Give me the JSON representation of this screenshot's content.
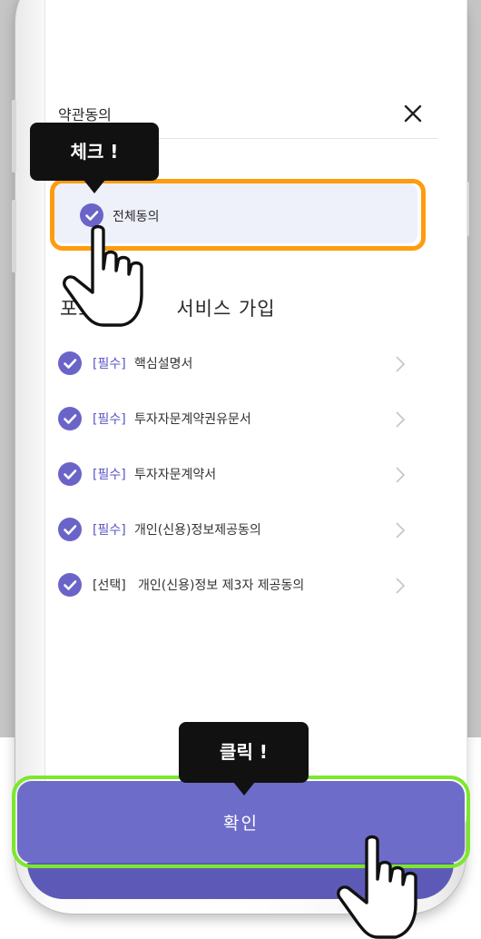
{
  "header": {
    "title": "약관동의",
    "close_icon": "close-icon"
  },
  "tooltips": {
    "check": "체크 !",
    "click": "클릭 !"
  },
  "all_agree": {
    "label": "전체동의",
    "checked": true
  },
  "section": {
    "title_start": "포트",
    "title_end": " 서비스 가입"
  },
  "terms": [
    {
      "tag": "[필수]",
      "label": "핵심설명서",
      "required": true,
      "checked": true
    },
    {
      "tag": "[필수]",
      "label": "투자자문계약권유문서",
      "required": true,
      "checked": true
    },
    {
      "tag": "[필수]",
      "label": "투자자문계약서",
      "required": true,
      "checked": true
    },
    {
      "tag": "[필수]",
      "label": "개인(신용)정보제공동의",
      "required": true,
      "checked": true
    },
    {
      "tag": "[선택]",
      "label": "개인(신용)정보 제3자 제공동의",
      "required": false,
      "checked": true
    }
  ],
  "confirm_button": {
    "label": "확인"
  },
  "colors": {
    "accent": "#6e6cc9",
    "check": "#6b64c8",
    "highlight_orange": "#ff9b0f",
    "highlight_green": "#7be82a",
    "tooltip_bg": "#111111"
  }
}
